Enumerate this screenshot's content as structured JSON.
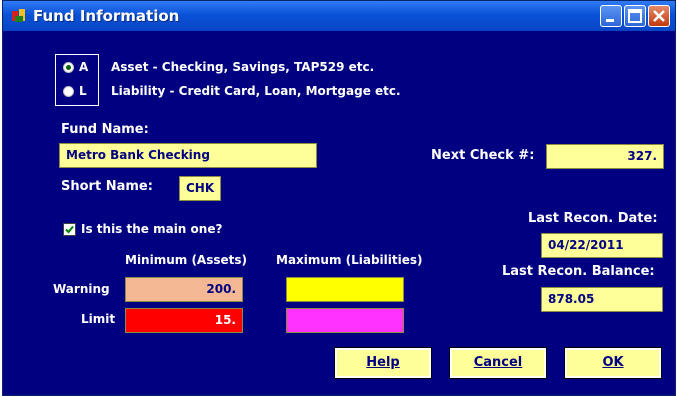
{
  "window": {
    "title": "Fund Information"
  },
  "fund_type": {
    "options": [
      {
        "letter": "A",
        "description": "Asset - Checking, Savings, TAP529 etc.",
        "selected": true
      },
      {
        "letter": "L",
        "description": "Liability - Credit Card, Loan, Mortgage etc.",
        "selected": false
      }
    ]
  },
  "fund_name": {
    "label": "Fund Name:",
    "value": "Metro Bank Checking"
  },
  "short_name": {
    "label": "Short Name:",
    "value": "CHK"
  },
  "next_check": {
    "label": "Next Check #:",
    "value": "327."
  },
  "main_one": {
    "label": "Is this the main one?",
    "checked": true
  },
  "last_recon_date": {
    "label": "Last Recon. Date:",
    "value": "04/22/2011"
  },
  "last_recon_balance": {
    "label": "Last Recon. Balance:",
    "value": "878.05"
  },
  "limits": {
    "min_header": "Minimum (Assets)",
    "max_header": "Maximum (Liabilities)",
    "warning_label": "Warning",
    "limit_label": "Limit",
    "warning_min": "200.",
    "warning_max": "",
    "limit_min": "15.",
    "limit_max": ""
  },
  "buttons": {
    "help": "Help",
    "cancel": "Cancel",
    "ok": "OK"
  },
  "colors": {
    "window_bg": "#000080",
    "field_bg": "#ffff99",
    "warning_min_bg": "#f5b894",
    "warning_max_bg": "#ffff00",
    "limit_min_bg": "#ff0000",
    "limit_max_bg": "#ff33ff"
  }
}
